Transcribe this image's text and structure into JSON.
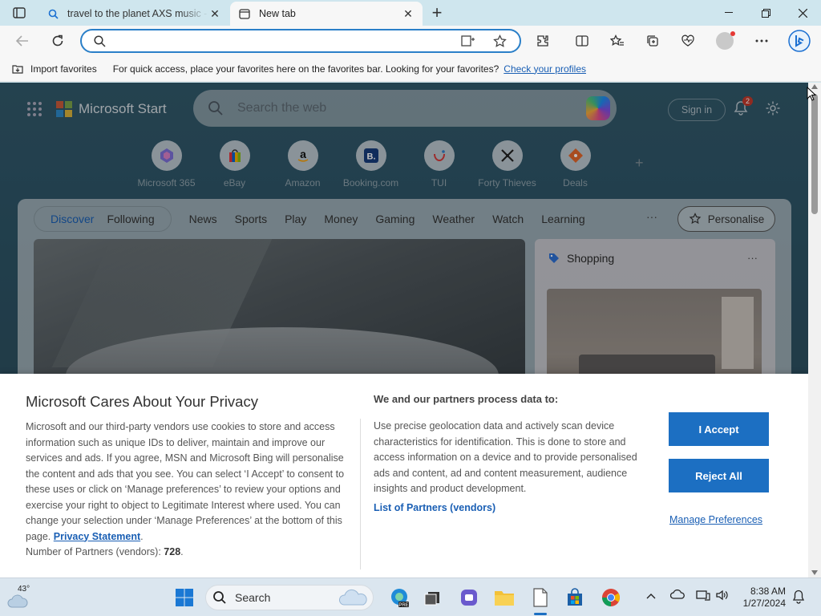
{
  "tabs": [
    {
      "title": "travel to the planet AXS music - Search",
      "active": false,
      "favicon": "search-icon"
    },
    {
      "title": "New tab",
      "active": true,
      "favicon": "newtab-icon"
    }
  ],
  "address_bar": {
    "value": "",
    "placeholder": ""
  },
  "favorites_bar": {
    "import_label": "Import favorites",
    "message": "For quick access, place your favorites here on the favorites bar. Looking for your favorites?",
    "link_label": "Check your profiles"
  },
  "msn": {
    "brand": "Microsoft Start",
    "search_placeholder": "Search the web",
    "sign_in": "Sign in",
    "notification_count": "2",
    "quick_links": [
      {
        "label": "Microsoft 365",
        "icon": "m365-icon"
      },
      {
        "label": "eBay",
        "icon": "ebay-icon"
      },
      {
        "label": "Amazon",
        "icon": "amazon-icon"
      },
      {
        "label": "Booking.com",
        "icon": "booking-icon"
      },
      {
        "label": "TUI",
        "icon": "tui-icon"
      },
      {
        "label": "Forty Thieves",
        "icon": "forty-thieves-icon"
      },
      {
        "label": "Deals",
        "icon": "deals-icon"
      }
    ],
    "feed_tabs_selected": "Discover",
    "feed_tabs_following": "Following",
    "nav_items": [
      "News",
      "Sports",
      "Play",
      "Money",
      "Gaming",
      "Weather",
      "Watch",
      "Learning"
    ],
    "more": "···",
    "personalise": "Personalise",
    "shopping_title": "Shopping",
    "shopping_more": "···"
  },
  "privacy": {
    "title": "Microsoft Cares About Your Privacy",
    "body": "Microsoft and our third-party vendors use cookies to store and access information such as unique IDs to deliver, maintain and improve our services and ads. If you agree, MSN and Microsoft Bing will personalise the content and ads that you see. You can select ‘I Accept’ to consent to these uses or click on ‘Manage preferences’ to review your options and exercise your right to object to Legitimate Interest where used.  You can change your selection under ‘Manage Preferences’ at the bottom of this page.",
    "privacy_link": "Privacy Statement",
    "partners_count_label": "Number of Partners (vendors):",
    "partners_count": "728",
    "subtitle": "We and our partners process data to:",
    "purposes": "Use precise geolocation data and actively scan device characteristics for identification. This is done to store and access information on a device and to provide personalised ads and content, ad and content measurement, audience insights and product development.",
    "partners_link": "List of Partners (vendors)",
    "accept": "I Accept",
    "reject": "Reject All",
    "manage": "Manage Preferences"
  },
  "taskbar": {
    "temperature": "43°",
    "search_label": "Search",
    "time": "8:38 AM",
    "date": "1/27/2024"
  },
  "colors": {
    "accent": "#1c6fc2",
    "link": "#1a5fb4",
    "chrome_bg": "#cfe6ee"
  }
}
